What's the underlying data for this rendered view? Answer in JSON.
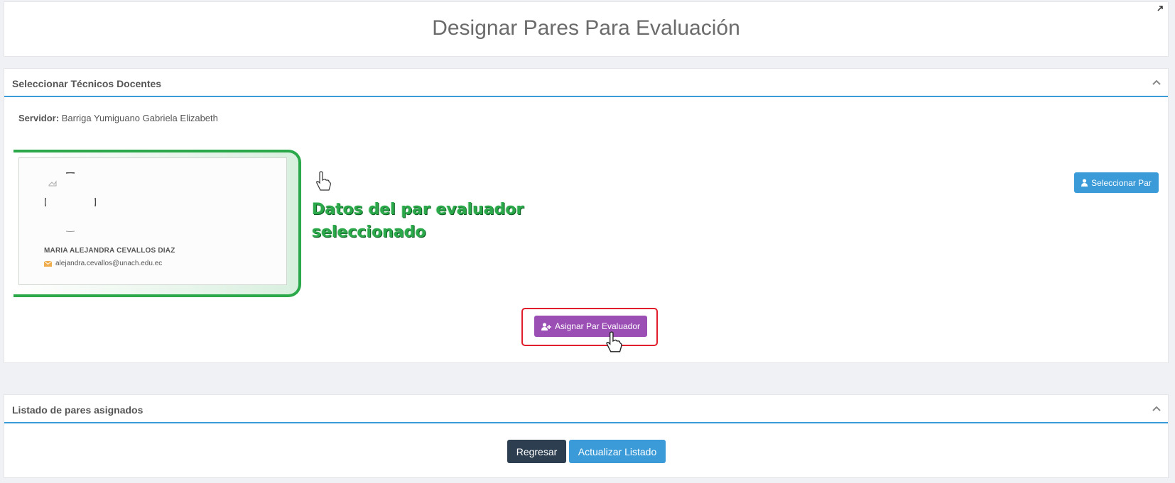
{
  "header": {
    "title": "Designar Pares Para Evaluación"
  },
  "section_select": {
    "title": "Seleccionar Técnicos Docentes",
    "servidor_label": "Servidor:",
    "servidor_value": "Barriga Yumiguano Gabriela Elizabeth",
    "select_button_label": "Seleccionar Par",
    "card": {
      "name": "MARIA ALEJANDRA CEVALLOS DIAZ",
      "email": "alejandra.cevallos@unach.edu.ec"
    },
    "annotation_line1": "Datos del par evaluador",
    "annotation_line2": "seleccionado",
    "assign_button_label": "Asignar Par Evaluador"
  },
  "section_list": {
    "title": "Listado de pares asignados",
    "back_button_label": "Regresar",
    "refresh_button_label": "Actualizar Listado"
  },
  "colors": {
    "accent_blue": "#3a9bd8",
    "assign_purple": "#9b4fb5",
    "back_dark": "#2c3e50",
    "annotation_green": "#2aa84a",
    "highlight_red": "#e01e2c"
  },
  "icons": [
    "expand-icon",
    "chevron-up-icon",
    "user-icon",
    "user-plus-icon",
    "envelope-icon",
    "hand-pointer-icon",
    "photo-icon"
  ]
}
